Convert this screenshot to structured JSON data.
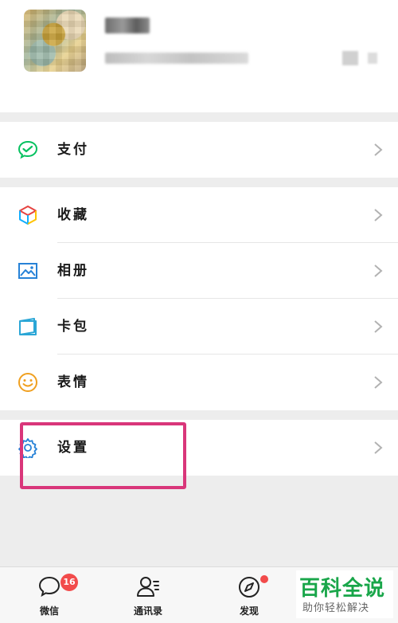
{
  "menu": {
    "pay": {
      "label": "支付",
      "icon": "wechat-pay-icon"
    },
    "favorites": {
      "label": "收藏",
      "icon": "cube-icon"
    },
    "album": {
      "label": "相册",
      "icon": "image-icon"
    },
    "cards": {
      "label": "卡包",
      "icon": "card-icon"
    },
    "stickers": {
      "label": "表情",
      "icon": "smiley-icon"
    },
    "settings": {
      "label": "设置",
      "icon": "gear-icon"
    }
  },
  "tabbar": {
    "chats": {
      "label": "微信",
      "badge": "16"
    },
    "contacts": {
      "label": "通讯录"
    },
    "discover": {
      "label": "发现"
    }
  },
  "watermark": {
    "title": "百科全说",
    "subtitle": "助你轻松解决"
  },
  "colors": {
    "accent_green": "#07c160",
    "highlight_pink": "#d9367a",
    "badge_red": "#f24b4b"
  }
}
